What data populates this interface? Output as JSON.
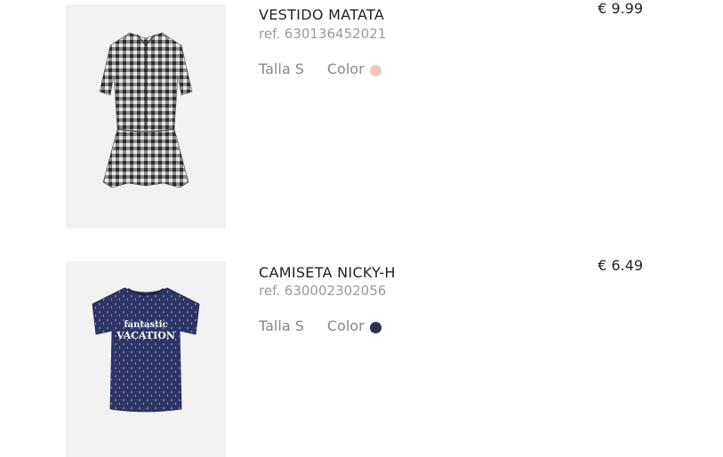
{
  "cart": {
    "items": [
      {
        "name": "VESTIDO MATATA",
        "ref": "ref. 630136452021",
        "size": "Talla S",
        "color_label": "Color",
        "color_hex": "#f5c8b6",
        "price": "€ 9.99",
        "image": "gingham-dress"
      },
      {
        "name": "CAMISETA NICKY-H",
        "ref": "ref. 630002302056",
        "size": "Talla S",
        "color_label": "Color",
        "color_hex": "#2a3050",
        "price": "€ 6.49",
        "image": "navy-tshirt",
        "print_text": [
          "fantastic",
          "VACATION"
        ]
      }
    ]
  }
}
